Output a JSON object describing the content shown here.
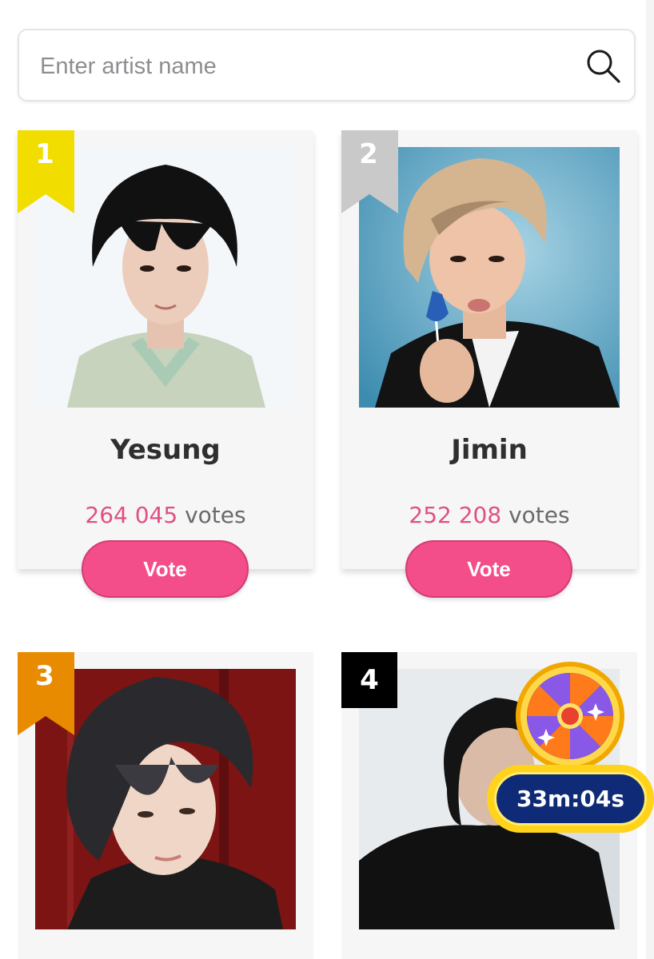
{
  "search": {
    "placeholder": "Enter artist name",
    "icon": "search-icon"
  },
  "colors": {
    "accent_pink": "#f44e8a",
    "votes_pink": "#e14f84",
    "rank_gold": "#f2dd00",
    "rank_silver": "#c9c9c9",
    "rank_bronze": "#e88b00",
    "rank_other": "#000000",
    "timer_navy": "#0f2a76",
    "timer_yellow": "#ffd21c"
  },
  "artists": [
    {
      "rank": "1",
      "name": "Yesung",
      "votes": "264 045",
      "votes_suffix": "votes",
      "vote_label": "Vote"
    },
    {
      "rank": "2",
      "name": "Jimin",
      "votes": "252 208",
      "votes_suffix": "votes",
      "vote_label": "Vote"
    },
    {
      "rank": "3"
    },
    {
      "rank": "4"
    }
  ],
  "promo": {
    "icon": "prize-wheel-icon",
    "timer": "33m:04s"
  }
}
